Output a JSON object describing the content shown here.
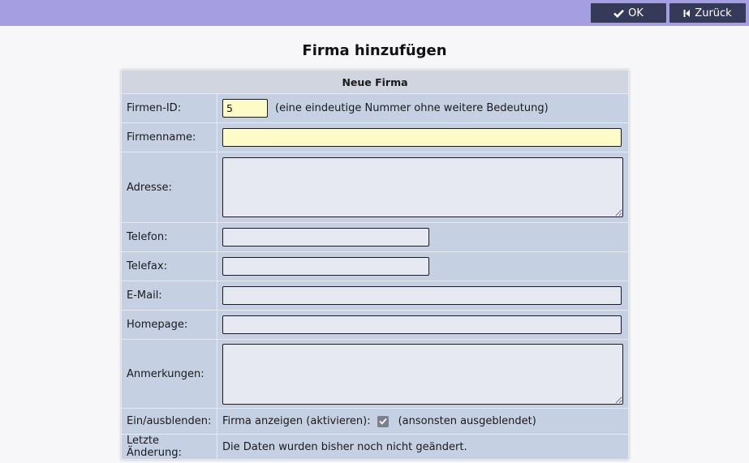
{
  "toolbar": {
    "ok_label": "OK",
    "back_label": "Zurück"
  },
  "page": {
    "title": "Firma hinzufügen"
  },
  "form": {
    "header": "Neue Firma",
    "fields": {
      "id": {
        "label": "Firmen-ID:",
        "value": "5",
        "hint": "(eine eindeutige Nummer ohne weitere Bedeutung)"
      },
      "name": {
        "label": "Firmenname:",
        "value": ""
      },
      "address": {
        "label": "Adresse:",
        "value": ""
      },
      "phone": {
        "label": "Telefon:",
        "value": ""
      },
      "fax": {
        "label": "Telefax:",
        "value": ""
      },
      "email": {
        "label": "E-Mail:",
        "value": ""
      },
      "homepage": {
        "label": "Homepage:",
        "value": ""
      },
      "notes": {
        "label": "Anmerkungen:",
        "value": ""
      },
      "visibility": {
        "label": "Ein/ausblenden:",
        "checkbox_label": "Firma anzeigen (aktivieren):",
        "checked": true,
        "hint": "(ansonsten ausgeblendet)"
      },
      "last_change": {
        "label": "Letzte Änderung:",
        "value": "Die Daten wurden bisher noch nicht geändert."
      }
    }
  },
  "colors": {
    "topbar": "#a59fe2",
    "button": "#363a59",
    "row": "#c5d0e3",
    "header": "#d0d5e0",
    "highlight_field": "#fefbc8"
  }
}
